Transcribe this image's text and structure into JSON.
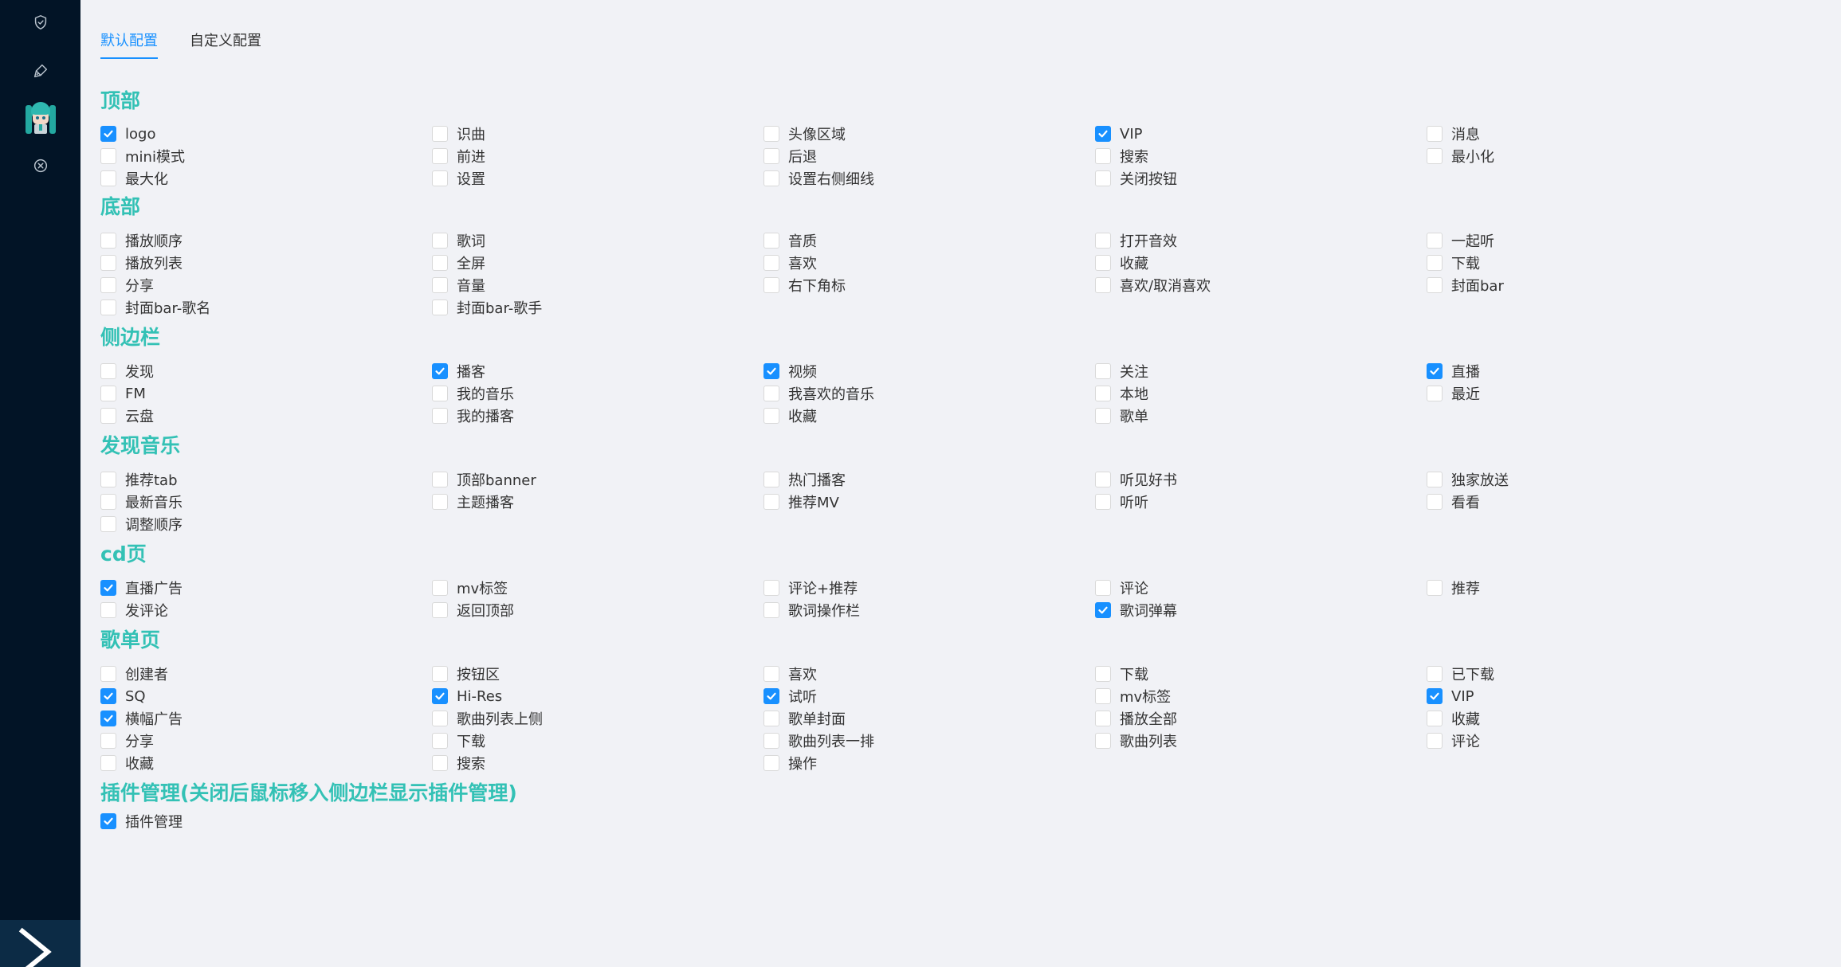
{
  "sidebar": {
    "icons": [
      "shield-check-icon",
      "brush-icon",
      "avatar",
      "close-circle-icon"
    ],
    "footer_icon": "chevron-right-icon"
  },
  "tabs": [
    {
      "label": "默认配置",
      "active": true
    },
    {
      "label": "自定义配置",
      "active": false
    }
  ],
  "sections": [
    {
      "title": "顶部",
      "items": [
        {
          "label": "logo",
          "checked": true
        },
        {
          "label": "识曲",
          "checked": false
        },
        {
          "label": "头像区域",
          "checked": false
        },
        {
          "label": "VIP",
          "checked": true
        },
        {
          "label": "消息",
          "checked": false
        },
        {
          "label": "mini模式",
          "checked": false
        },
        {
          "label": "前进",
          "checked": false
        },
        {
          "label": "后退",
          "checked": false
        },
        {
          "label": "搜索",
          "checked": false
        },
        {
          "label": "最小化",
          "checked": false
        },
        {
          "label": "最大化",
          "checked": false
        },
        {
          "label": "设置",
          "checked": false
        },
        {
          "label": "设置右侧细线",
          "checked": false
        },
        {
          "label": "关闭按钮",
          "checked": false
        }
      ]
    },
    {
      "title": "底部",
      "items": [
        {
          "label": "播放顺序",
          "checked": false
        },
        {
          "label": "歌词",
          "checked": false
        },
        {
          "label": "音质",
          "checked": false
        },
        {
          "label": "打开音效",
          "checked": false
        },
        {
          "label": "一起听",
          "checked": false
        },
        {
          "label": "播放列表",
          "checked": false
        },
        {
          "label": "全屏",
          "checked": false
        },
        {
          "label": "喜欢",
          "checked": false
        },
        {
          "label": "收藏",
          "checked": false
        },
        {
          "label": "下载",
          "checked": false
        },
        {
          "label": "分享",
          "checked": false
        },
        {
          "label": "音量",
          "checked": false
        },
        {
          "label": "右下角标",
          "checked": false
        },
        {
          "label": "喜欢/取消喜欢",
          "checked": false
        },
        {
          "label": "封面bar",
          "checked": false
        },
        {
          "label": "封面bar-歌名",
          "checked": false
        },
        {
          "label": "封面bar-歌手",
          "checked": false
        }
      ]
    },
    {
      "title": "侧边栏",
      "items": [
        {
          "label": "发现",
          "checked": false
        },
        {
          "label": "播客",
          "checked": true
        },
        {
          "label": "视频",
          "checked": true
        },
        {
          "label": "关注",
          "checked": false
        },
        {
          "label": "直播",
          "checked": true
        },
        {
          "label": "FM",
          "checked": false
        },
        {
          "label": "我的音乐",
          "checked": false
        },
        {
          "label": "我喜欢的音乐",
          "checked": false
        },
        {
          "label": "本地",
          "checked": false
        },
        {
          "label": "最近",
          "checked": false
        },
        {
          "label": "云盘",
          "checked": false
        },
        {
          "label": "我的播客",
          "checked": false
        },
        {
          "label": "收藏",
          "checked": false
        },
        {
          "label": "歌单",
          "checked": false
        }
      ]
    },
    {
      "title": "发现音乐",
      "items": [
        {
          "label": "推荐tab",
          "checked": false
        },
        {
          "label": "顶部banner",
          "checked": false
        },
        {
          "label": "热门播客",
          "checked": false
        },
        {
          "label": "听见好书",
          "checked": false
        },
        {
          "label": "独家放送",
          "checked": false
        },
        {
          "label": "最新音乐",
          "checked": false
        },
        {
          "label": "主题播客",
          "checked": false
        },
        {
          "label": "推荐MV",
          "checked": false
        },
        {
          "label": "听听",
          "checked": false
        },
        {
          "label": "看看",
          "checked": false
        },
        {
          "label": "调整顺序",
          "checked": false
        }
      ]
    },
    {
      "title": "cd页",
      "items": [
        {
          "label": "直播广告",
          "checked": true
        },
        {
          "label": "mv标签",
          "checked": false
        },
        {
          "label": "评论+推荐",
          "checked": false
        },
        {
          "label": "评论",
          "checked": false
        },
        {
          "label": "推荐",
          "checked": false
        },
        {
          "label": "发评论",
          "checked": false
        },
        {
          "label": "返回顶部",
          "checked": false
        },
        {
          "label": "歌词操作栏",
          "checked": false
        },
        {
          "label": "歌词弹幕",
          "checked": true
        }
      ]
    },
    {
      "title": "歌单页",
      "items": [
        {
          "label": "创建者",
          "checked": false
        },
        {
          "label": "按钮区",
          "checked": false
        },
        {
          "label": "喜欢",
          "checked": false
        },
        {
          "label": "下载",
          "checked": false
        },
        {
          "label": "已下载",
          "checked": false
        },
        {
          "label": "SQ",
          "checked": true
        },
        {
          "label": "Hi-Res",
          "checked": true
        },
        {
          "label": "试听",
          "checked": true
        },
        {
          "label": "mv标签",
          "checked": false
        },
        {
          "label": "VIP",
          "checked": true
        },
        {
          "label": "横幅广告",
          "checked": true
        },
        {
          "label": "歌曲列表上侧",
          "checked": false
        },
        {
          "label": "歌单封面",
          "checked": false
        },
        {
          "label": "播放全部",
          "checked": false
        },
        {
          "label": "收藏",
          "checked": false
        },
        {
          "label": "分享",
          "checked": false
        },
        {
          "label": "下载",
          "checked": false
        },
        {
          "label": "歌曲列表一排",
          "checked": false
        },
        {
          "label": "歌曲列表",
          "checked": false
        },
        {
          "label": "评论",
          "checked": false
        },
        {
          "label": "收藏",
          "checked": false
        },
        {
          "label": "搜索",
          "checked": false
        },
        {
          "label": "操作",
          "checked": false
        }
      ]
    },
    {
      "title": "插件管理(关闭后鼠标移入侧边栏显示插件管理)",
      "items": [
        {
          "label": "插件管理",
          "checked": true
        }
      ]
    }
  ]
}
